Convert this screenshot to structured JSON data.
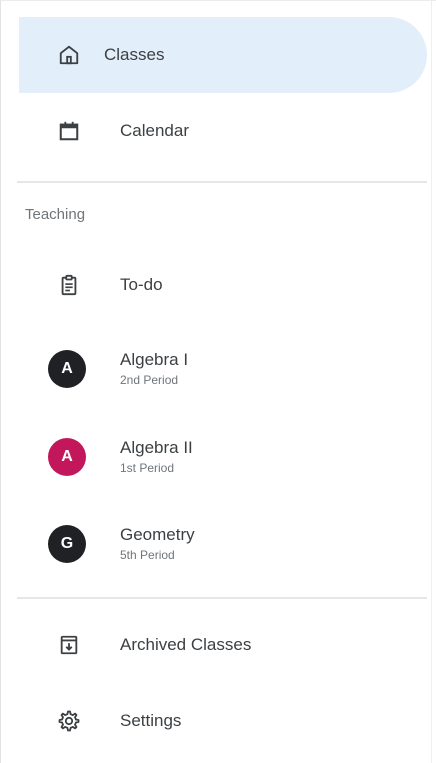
{
  "nav": {
    "classes": {
      "label": "Classes",
      "icon": "home-icon"
    },
    "calendar": {
      "label": "Calendar",
      "icon": "calendar-icon"
    }
  },
  "teaching": {
    "section_label": "Teaching",
    "todo": {
      "label": "To-do",
      "icon": "clipboard-icon"
    },
    "classes": [
      {
        "name": "Algebra I",
        "period": "2nd Period",
        "initial": "A",
        "color": "#202124"
      },
      {
        "name": "Algebra II",
        "period": "1st Period",
        "initial": "A",
        "color": "#c2185b"
      },
      {
        "name": "Geometry",
        "period": "5th Period",
        "initial": "G",
        "color": "#202124"
      }
    ]
  },
  "footer": {
    "archived": {
      "label": "Archived Classes",
      "icon": "archive-icon"
    },
    "settings": {
      "label": "Settings",
      "icon": "gear-icon"
    }
  },
  "colors": {
    "active_bg": "#e3eefb",
    "text": "#3c4043",
    "subtext": "#70757a"
  }
}
